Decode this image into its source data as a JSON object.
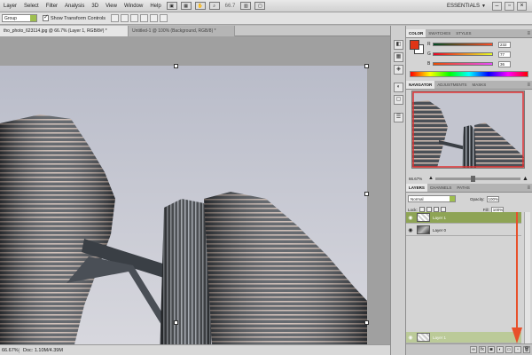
{
  "menubar": {
    "items": [
      "Layer",
      "Select",
      "Filter",
      "Analysis",
      "3D",
      "View",
      "Window",
      "Help"
    ],
    "zoom": "66.7",
    "essentials": "ESSENTIALS"
  },
  "options": {
    "auto_select_value": "Group",
    "show_transform_label": "Show Transform Controls"
  },
  "tabs": [
    {
      "label": "tho_photo_623114.jpg @ 66.7% (Layer 1, RGB/8#) *",
      "active": true
    },
    {
      "label": "Untitled-1 @ 100% (Background, RGB/8) *",
      "active": false
    }
  ],
  "status": {
    "zoom": "66.67%",
    "doc": "Doc: 1.10M/4.39M"
  },
  "color_panel": {
    "tabs": [
      "COLOR",
      "SWATCHES",
      "STYLES"
    ],
    "foreground": "#e03516",
    "background": "#ffffff",
    "sliders": [
      {
        "letter": "R",
        "value": "232"
      },
      {
        "letter": "G",
        "value": "77"
      },
      {
        "letter": "B",
        "value": "36"
      }
    ]
  },
  "navigator_panel": {
    "tabs": [
      "NAVIGATOR",
      "ADJUSTMENTS",
      "MASKS"
    ],
    "zoom": "66.67%",
    "view_box_color": "#e03030"
  },
  "layers_panel": {
    "tabs": [
      "LAYERS",
      "CHANNELS",
      "PATHS"
    ],
    "blend_mode": "Normal",
    "opacity_label": "Opacity:",
    "opacity_value": "100%",
    "lock_label": "Lock:",
    "fill_label": "Fill:",
    "fill_value": "100%",
    "layers": [
      {
        "name": "Layer 1",
        "selected": true
      },
      {
        "name": "Layer 0",
        "selected": false
      }
    ],
    "drag_layer": "Layer 1"
  },
  "colors": {
    "accent_green": "#8ea455",
    "arrow": "#e8502a"
  }
}
